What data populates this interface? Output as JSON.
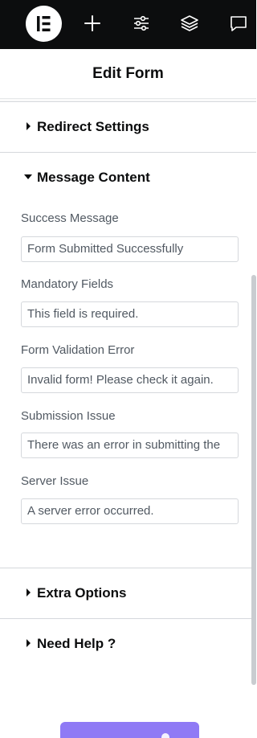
{
  "topbar": {
    "icons": [
      "elementor-logo-icon",
      "plus-icon",
      "sliders-icon",
      "layers-icon",
      "chat-icon"
    ]
  },
  "header": {
    "title": "Edit Form"
  },
  "sections": {
    "redirect": "Redirect Settings",
    "message": "Message Content",
    "extra": "Extra Options",
    "help": "Need Help ?"
  },
  "fields": [
    {
      "label": "Success Message",
      "value": "Form Submitted Successfully"
    },
    {
      "label": "Mandatory Fields",
      "value": "This field is required."
    },
    {
      "label": "Form Validation Error",
      "value": "Invalid form! Please check it again."
    },
    {
      "label": "Submission Issue",
      "value": "There was an error in submitting the"
    },
    {
      "label": "Server Issue",
      "value": "A server error occurred."
    }
  ],
  "colors": {
    "topbar": "#0c0d0e",
    "accent": "#8f7af5",
    "border": "#d5d8dc"
  }
}
